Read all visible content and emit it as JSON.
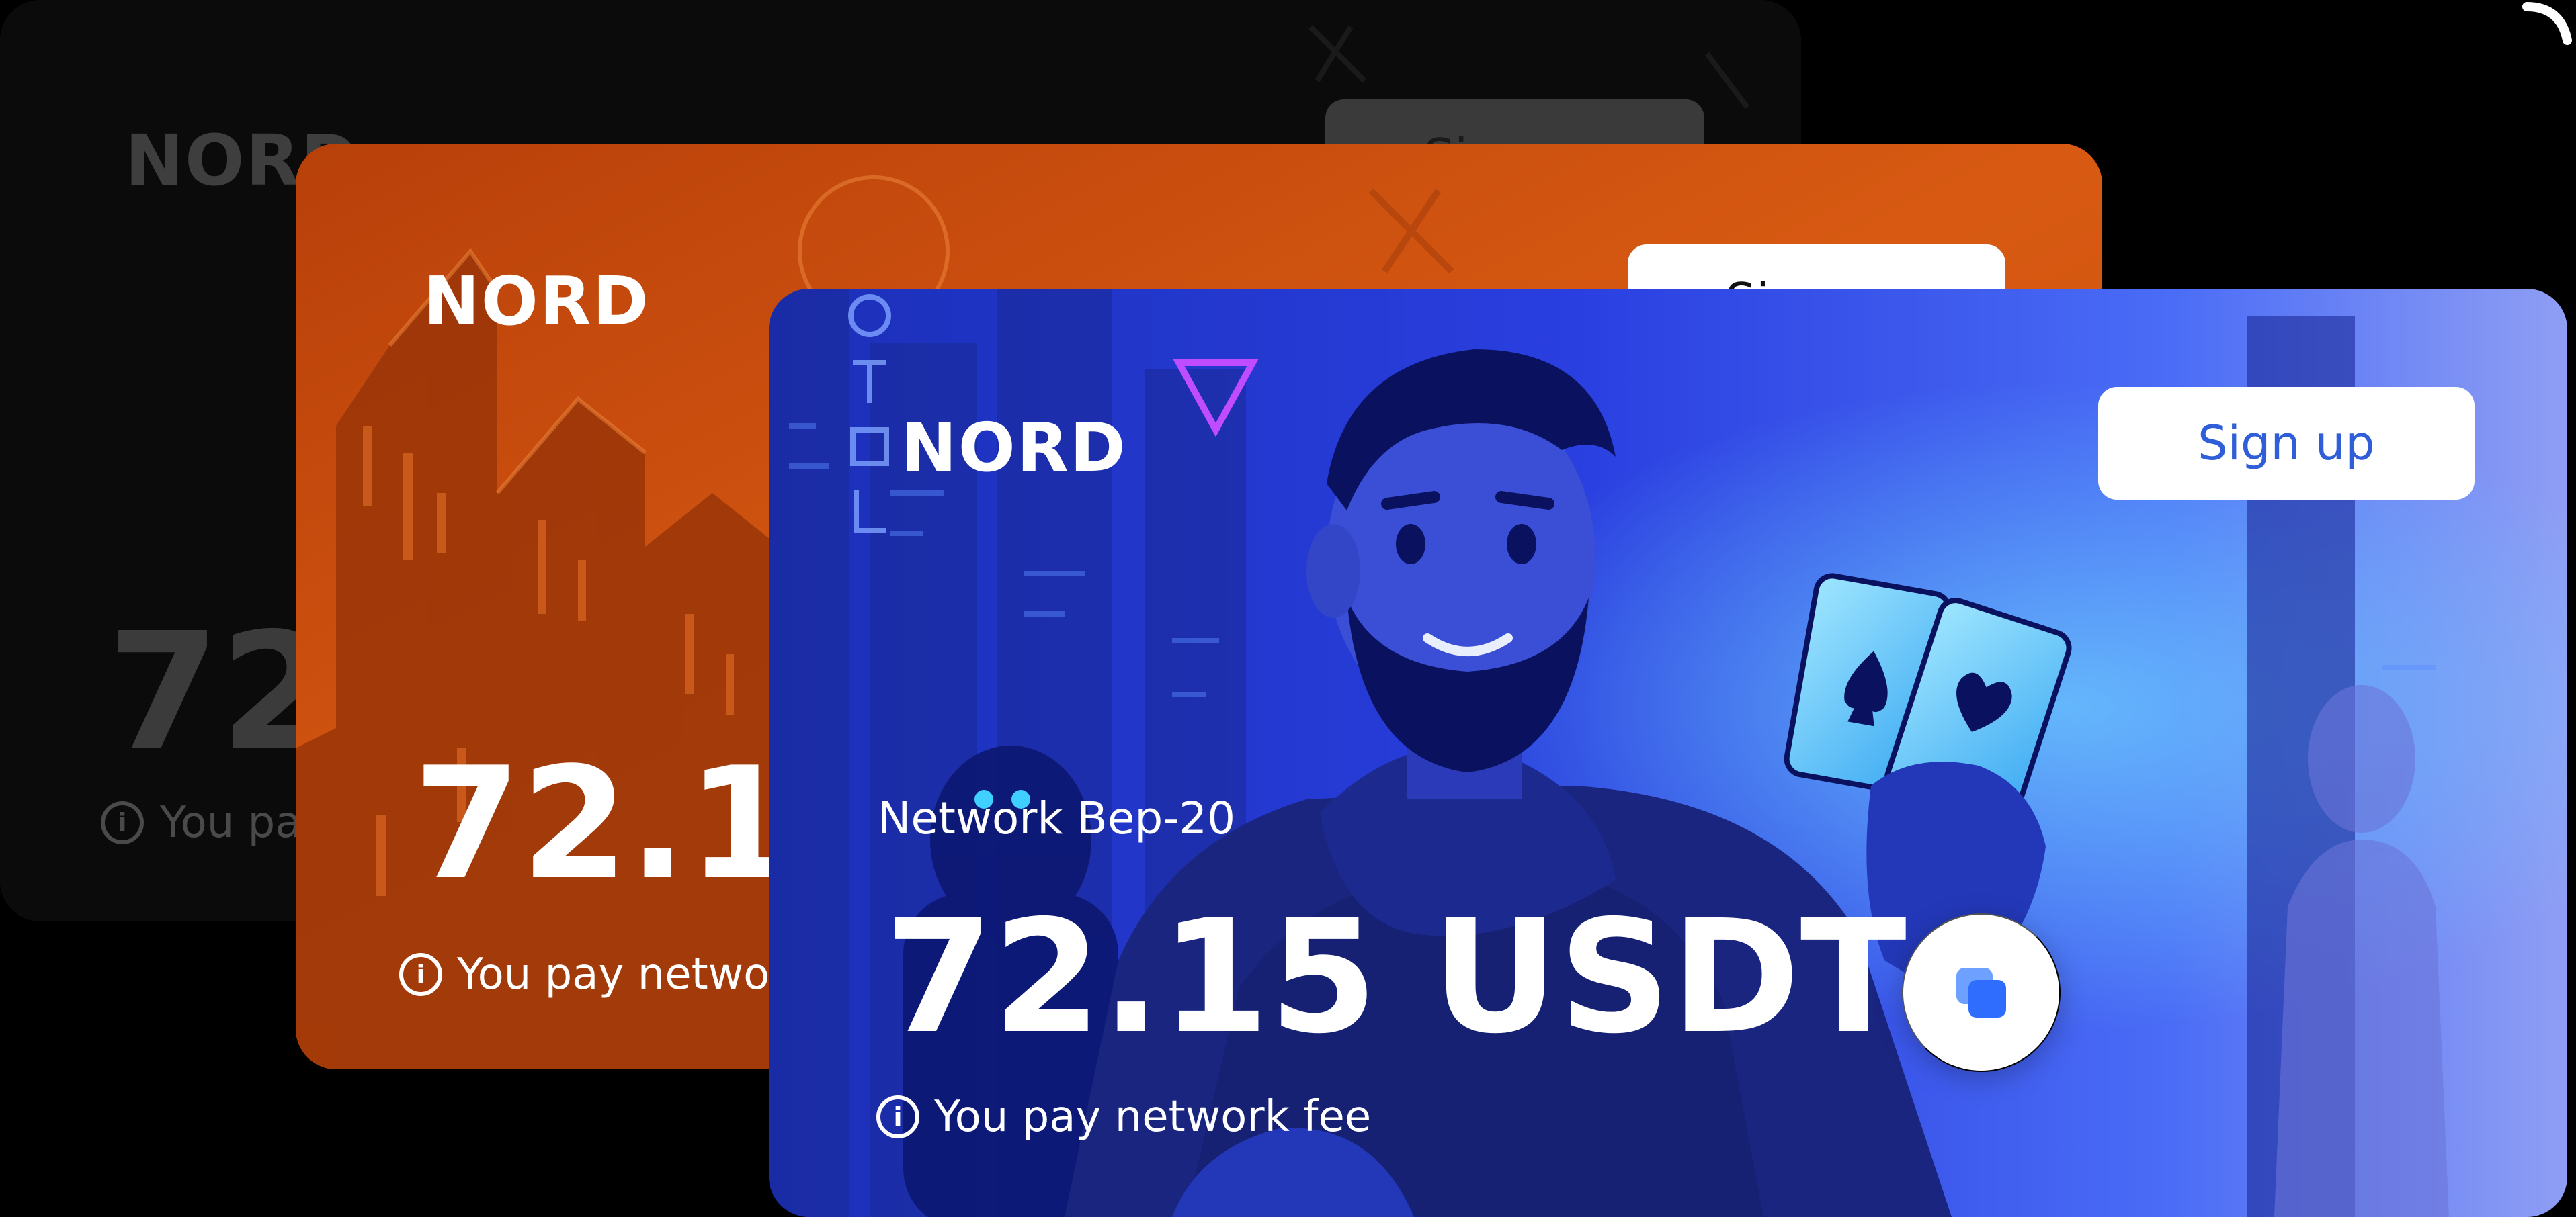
{
  "cards": {
    "back": {
      "logo": "NORD",
      "signup_label": "Sign up",
      "amount": "72.15 USDT",
      "fee_text": "You pay network fee"
    },
    "middle": {
      "logo": "NORD",
      "signup_label": "Sign up",
      "amount": "72.15 USDT",
      "fee_text": "You pay network fee"
    },
    "front": {
      "logo": "NORD",
      "signup_label": "Sign up",
      "network": "Network Bep-20",
      "amount": "72.15 USDT",
      "fee_text": "You pay network fee",
      "info_glyph": "i"
    }
  },
  "icons": {
    "info": "info-circle-icon",
    "copy": "copy-icon",
    "spade": "spade-icon",
    "heart": "heart-icon"
  },
  "colors": {
    "background": "#000000",
    "dark_card": "#0b0b0b",
    "orange_card": "#d2510f",
    "blue_card": "#2d40e0",
    "signup_text": "#2f5ed8",
    "copy_icon": "#3b7bff"
  }
}
